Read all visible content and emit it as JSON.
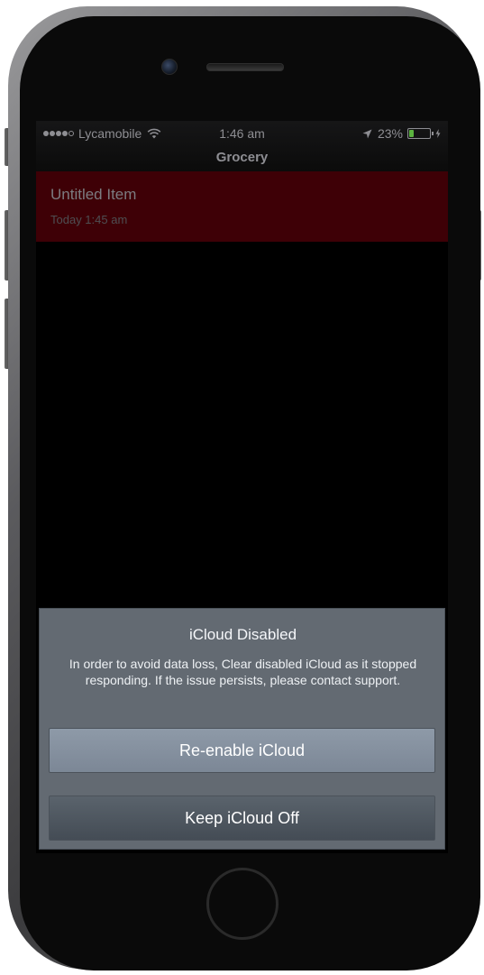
{
  "status_bar": {
    "carrier": "Lycamobile",
    "time": "1:46 am",
    "battery_percent": "23%",
    "battery_level": 0.23,
    "battery_fill_color": "#5bb33f",
    "signal_bars_filled": 4,
    "signal_bars_total": 5
  },
  "navigation": {
    "title": "Grocery"
  },
  "list": {
    "items": [
      {
        "title": "Untitled Item",
        "subtitle": "Today 1:45 am",
        "background_color": "#3e0006"
      }
    ]
  },
  "alert": {
    "title": "iCloud Disabled",
    "message": "In order to avoid data loss, Clear disabled iCloud as it stopped responding. If the issue persists, please contact support.",
    "buttons": [
      {
        "label": "Re-enable iCloud"
      },
      {
        "label": "Keep iCloud Off"
      }
    ]
  },
  "device": {
    "model": "iPhone",
    "icons": [
      "camera-icon",
      "speaker-grille",
      "home-button"
    ]
  }
}
